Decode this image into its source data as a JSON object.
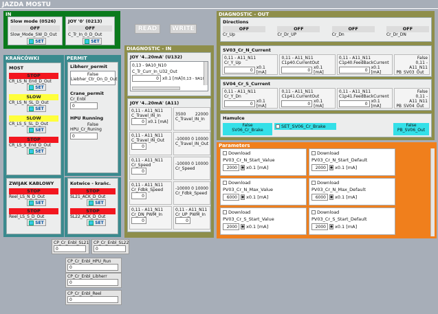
{
  "title": "JAZDA MOSTU",
  "in": {
    "label": "IN",
    "slow_mode": {
      "title": "Slow mode (0526)",
      "state": "OFF",
      "name": "Slow_Mode_SW_D_Out",
      "btn": "SET"
    },
    "joy0": {
      "title": "JOY '0' (0213)",
      "state": "OFF",
      "name": "C_Tr_In_0_D_Out",
      "btn": "SET"
    }
  },
  "buttons": {
    "read": "READ",
    "write": "WRITE"
  },
  "krancowki": {
    "title": "KRAŃCÓWKI",
    "most": "MOST",
    "items": [
      {
        "state": "STOP",
        "name": "CR_LS_N_End_D_Out",
        "cls": "stop",
        "btn": "SET"
      },
      {
        "state": "SLOW",
        "name": "CR_LS_N_SL_D_Out",
        "cls": "slow",
        "btn": "SET"
      },
      {
        "state": "SLOW",
        "name": "CR_LS_S_SL_D_Out",
        "cls": "slow",
        "btn": "SET"
      },
      {
        "state": "STOP",
        "name": "CR_LS_S_End_D_Out",
        "cls": "stop",
        "btn": "SET"
      }
    ],
    "zwijak": "ZWIJAK KABLOWY",
    "zw_items": [
      {
        "state": "STOP",
        "name": "Reel_LS_N_D_Out",
        "cls": "stop",
        "btn": "SET"
      },
      {
        "state": "STOP",
        "name": "Reel_LS_S_D_Out",
        "cls": "stop",
        "btn": "SET"
      }
    ]
  },
  "permit": {
    "title": "PERMIT",
    "liebherr": {
      "title": "Libherr_permit",
      "state": "False",
      "name": "Liebher_Ctr_On_D_Out"
    },
    "crane": {
      "title": "Crane_permit",
      "name": "Cr_Enbl",
      "value": "0"
    },
    "hpu": {
      "title": "HPU Running",
      "state": "False",
      "name": "HPU_Cr_Runing",
      "value": "0"
    }
  },
  "kotwice": {
    "title": "Kotwice - krańc.",
    "items": [
      {
        "state": "STOP",
        "name": "SL21_ACK_D_Out",
        "btn": "SET"
      },
      {
        "state": "STOP",
        "name": "SL22_ACK_D_Out",
        "btn": "SET"
      }
    ]
  },
  "diag_in": {
    "title": "DIAGNOSTIC - IN",
    "joy132_title": "JOY '4..20mA' (U132)",
    "joy132": {
      "l1": "0,13 - 9A10_N10",
      "l2": "C_Tr_Curr_In_U32_Out",
      "val": "0",
      "unit": "x0.1 [mA]",
      "range": "0,13 - 9A10"
    },
    "a11_title": "JOY '4..20mA' (A11)",
    "cells": [
      {
        "a": "0,11 - A11_N11",
        "b": "C_Travel_IN_In",
        "val": "0",
        "unit": "x0.1 [mA]"
      },
      {
        "a": "3500",
        "b": "22000",
        "c": "C_Travel_IN_In"
      },
      {
        "a": "0,11 - A11_N11",
        "b": "C_Travel_IN_Out",
        "val": "0"
      },
      {
        "a": "-10000 0",
        "b": "10000",
        "c": "C_Travel_IN_Out"
      },
      {
        "a": "0,11 - A11_N11",
        "b": "Cr_Speed",
        "val": "0"
      },
      {
        "a": "-10000 0",
        "b": "10000",
        "c": "Cr_Speed"
      },
      {
        "a": "0,11 - A11_N11",
        "b": "Cr_Fdbk_Speed",
        "val": "0"
      },
      {
        "a": "-10000 0",
        "b": "10000",
        "c": "Cr_Fdbk_Speed"
      },
      {
        "a": "0,11 - A11_N11",
        "b": "Cr_DN_PWM_In",
        "val": "0"
      },
      {
        "a": "0,11 - A11_N11",
        "b": "Cr_UP_PWM_In",
        "val": "0"
      }
    ]
  },
  "diag_out": {
    "title": "DIAGNOSTIC - OUT",
    "directions": "Directions",
    "dirs": [
      {
        "state": "OFF",
        "name": "Cr_Up"
      },
      {
        "state": "OFF",
        "name": "Cr_Dr_UP"
      },
      {
        "state": "OFF",
        "name": "Cr_Dn"
      },
      {
        "state": "OFF",
        "name": "Cr_Dr_DN"
      }
    ],
    "sv03n": {
      "title": "SV03_Cr_N_Current",
      "c1": {
        "a": "0,11 - A11_N11",
        "b": "Cr_Y_Up",
        "val": "0",
        "unit": "x0.1 [mA]"
      },
      "c2": {
        "a": "0,11 - A11_N11",
        "b": "C1p40.CurrentOut",
        "val": "0",
        "unit": "x0.1 [mA]"
      },
      "c3": {
        "a": "0,11 - A11_N11",
        "b": "C1p40.FeedBackCurrent",
        "val": "0",
        "unit": "x0.1 [mA]"
      },
      "c4": {
        "a": "False",
        "b": "0,11 - A11_N11",
        "c": "PB_SV03_Out"
      }
    },
    "sv04s": {
      "title": "SV04_Cr_S_Current",
      "c1": {
        "a": "0,11 - A11_N11",
        "b": "Cr_Y_Dn",
        "val": "0",
        "unit": "x0.1 [mA]"
      },
      "c2": {
        "a": "0,11 - A11_N11",
        "b": "C1p41.CurrentOut",
        "val": "0",
        "unit": "x0.1 [mA]"
      },
      "c3": {
        "a": "0,11 - A11_N11",
        "b": "C1p41.FeedBackCurrent",
        "val": "0",
        "unit": "x0.1 [mA]"
      },
      "c4": {
        "a": "False",
        "b": "0,11 - A11_N11",
        "c": "PB_SV04_Out"
      }
    },
    "hamulce": {
      "title": "Hamulce",
      "state": "False",
      "name": "SV06_Cr_Brake",
      "set": "SET_SV06_Cr_Brake",
      "right_state": "False",
      "right_name": "PB_SV06_Out"
    }
  },
  "parameters": {
    "title": "Parameters",
    "download": "Download",
    "unit": "x0.1 [mA]",
    "items": [
      {
        "name": "PV03_Cr_N_Start_Value",
        "val": "2000"
      },
      {
        "name": "PV03_Cr_N_Start_Default",
        "val": "2000"
      },
      {
        "name": "PV03_Cr_N_Max_Value",
        "val": "6000"
      },
      {
        "name": "PV03_Cr_N_Max_Default",
        "val": "6000"
      },
      {
        "name": "PV03_Cr_S_Start_Value",
        "val": "2000"
      },
      {
        "name": "PV03_Cr_S_Start_Default",
        "val": "2000"
      }
    ]
  },
  "bottom": [
    {
      "name": "CP_Cr_Enbl_SL21",
      "val": "0"
    },
    {
      "name": "CP_Cr_Enbl_SL22",
      "val": "0"
    },
    {
      "name": "CP_Cr_Enbl_HPU_Run",
      "val": "0"
    },
    {
      "name": "CP_Cr_Enbl_Libherr",
      "val": "0"
    },
    {
      "name": "CP_Cr_Enbl_Reel",
      "val": "0"
    }
  ],
  "colors": {
    "bg": "#a7aeb8",
    "green": "#0a7a1c",
    "teal": "#3a8a8e",
    "olive": "#8e8e4a",
    "orange": "#f07f1c",
    "stop": "#f3161f",
    "slow": "#ffff3c"
  }
}
